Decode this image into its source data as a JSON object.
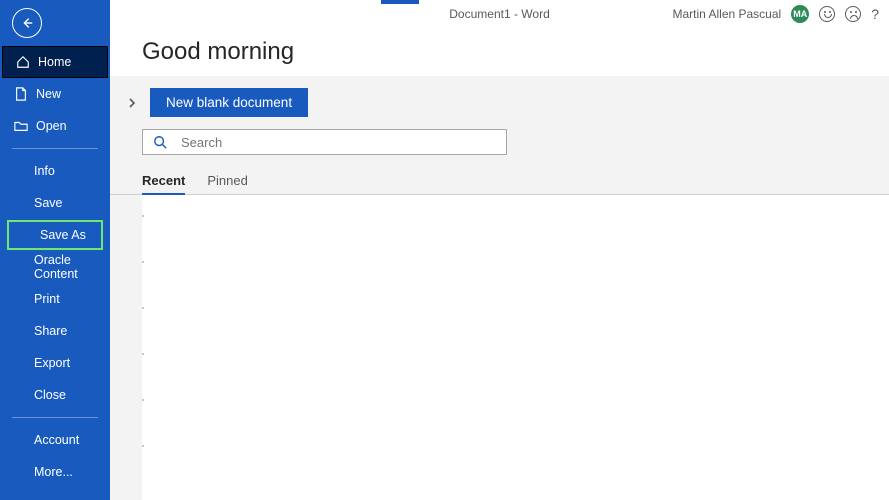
{
  "titlebar": {
    "document_title": "Document1  -  Word",
    "user_name": "Martin Allen Pascual",
    "avatar_initials": "MA"
  },
  "greeting": "Good morning",
  "sidebar": {
    "primary": [
      {
        "label": "Home",
        "icon": "home-icon",
        "selected": true
      },
      {
        "label": "New",
        "icon": "new-doc-icon",
        "selected": false
      },
      {
        "label": "Open",
        "icon": "open-folder-icon",
        "selected": false
      }
    ],
    "secondary": [
      {
        "label": "Info"
      },
      {
        "label": "Save"
      },
      {
        "label": "Save As",
        "highlighted": true
      },
      {
        "label": "Oracle Content"
      },
      {
        "label": "Print"
      },
      {
        "label": "Share"
      },
      {
        "label": "Export"
      },
      {
        "label": "Close"
      }
    ],
    "footer": [
      {
        "label": "Account"
      },
      {
        "label": "More..."
      }
    ]
  },
  "actions": {
    "new_blank_label": "New blank document"
  },
  "search": {
    "placeholder": "Search"
  },
  "list_tabs": [
    {
      "label": "Recent",
      "active": true
    },
    {
      "label": "Pinned",
      "active": false
    }
  ]
}
